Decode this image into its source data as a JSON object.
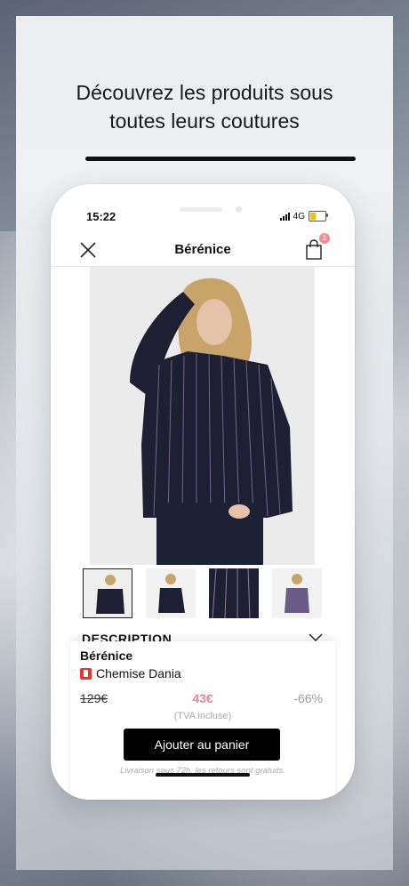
{
  "promo": {
    "headline_line1": "Découvrez les produits sous",
    "headline_line2": "toutes leurs coutures"
  },
  "status_bar": {
    "time": "15:22",
    "network": "4G"
  },
  "navbar": {
    "title": "Bérénice",
    "cart_badge": "1"
  },
  "gallery": {
    "thumbnails": [
      "thumb-1",
      "thumb-2",
      "thumb-3",
      "thumb-4"
    ]
  },
  "description": {
    "label": "DESCRIPTION"
  },
  "product": {
    "brand": "Bérénice",
    "name": "Chemise Dania",
    "price_old": "129€",
    "price_new": "43€",
    "discount": "-66%",
    "tax_note": "(TVA incluse)",
    "cta_label": "Ajouter au panier",
    "delivery_note": "Livraison sous 72h, les retours sont gratuits."
  },
  "colors": {
    "accent_price": "#e48a8f",
    "badge": "#f08f95",
    "cta_bg": "#000000",
    "shirt": "#1f1f33"
  }
}
